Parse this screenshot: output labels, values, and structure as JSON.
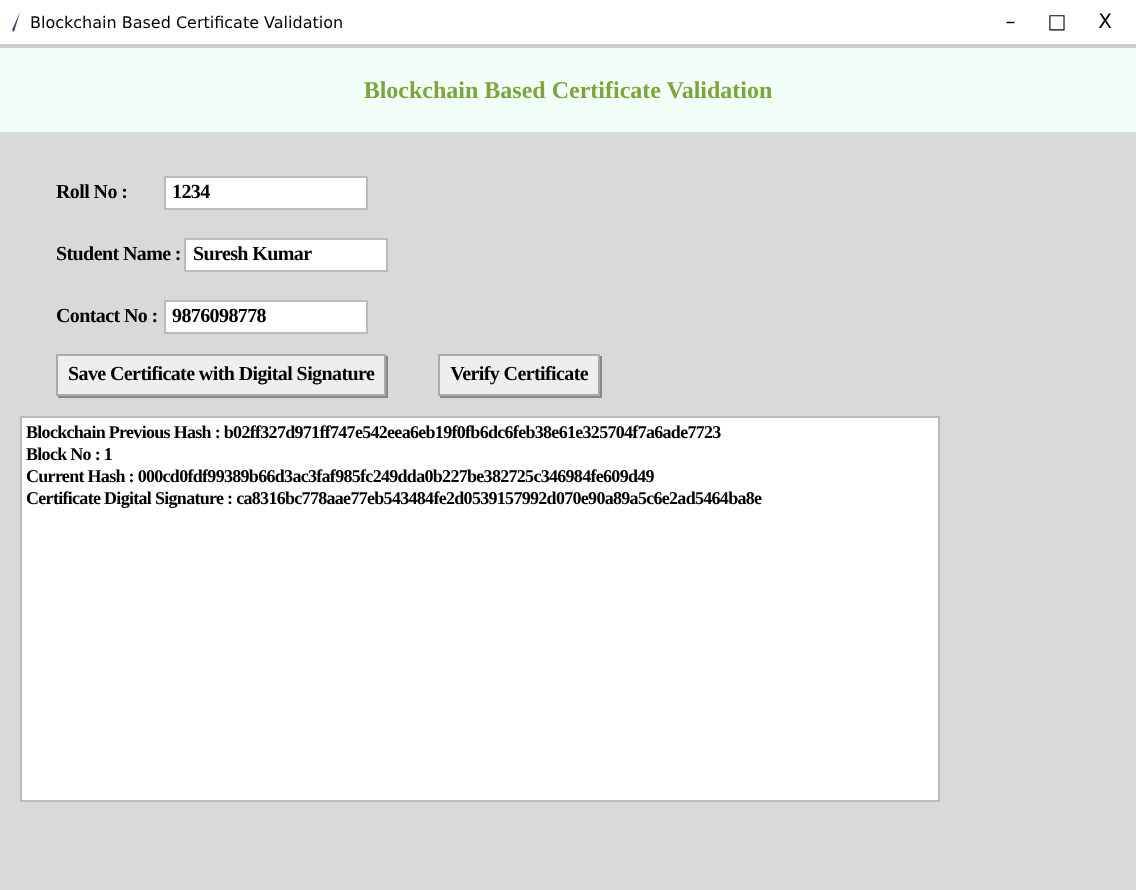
{
  "window": {
    "title": "Blockchain Based Certificate Validation",
    "controls": [
      "–",
      "□",
      "X"
    ]
  },
  "heading": "Blockchain Based Certificate Validation",
  "fields": [
    {
      "label": "Roll No :",
      "value": "1234"
    },
    {
      "label": "Student Name :",
      "value": "Suresh Kumar"
    },
    {
      "label": "Contact No :",
      "value": "9876098778"
    }
  ],
  "buttons": [
    "Save Certificate with Digital Signature",
    "Verify Certificate"
  ],
  "output": [
    "Blockchain Previous Hash : b02ff327d971ff747e542eea6eb19f0fb6dc6feb38e61e325704f7a6ade7723",
    "Block No : 1",
    "Current Hash : 000cd0fdf99389b66d3ac3faf985fc249dda0b227be382725c346984fe609d49",
    "Certificate Digital Signature : ca8316bc778aae77eb543484fe2d0539157992d070e90a89a5c6e2ad5464ba8e"
  ]
}
